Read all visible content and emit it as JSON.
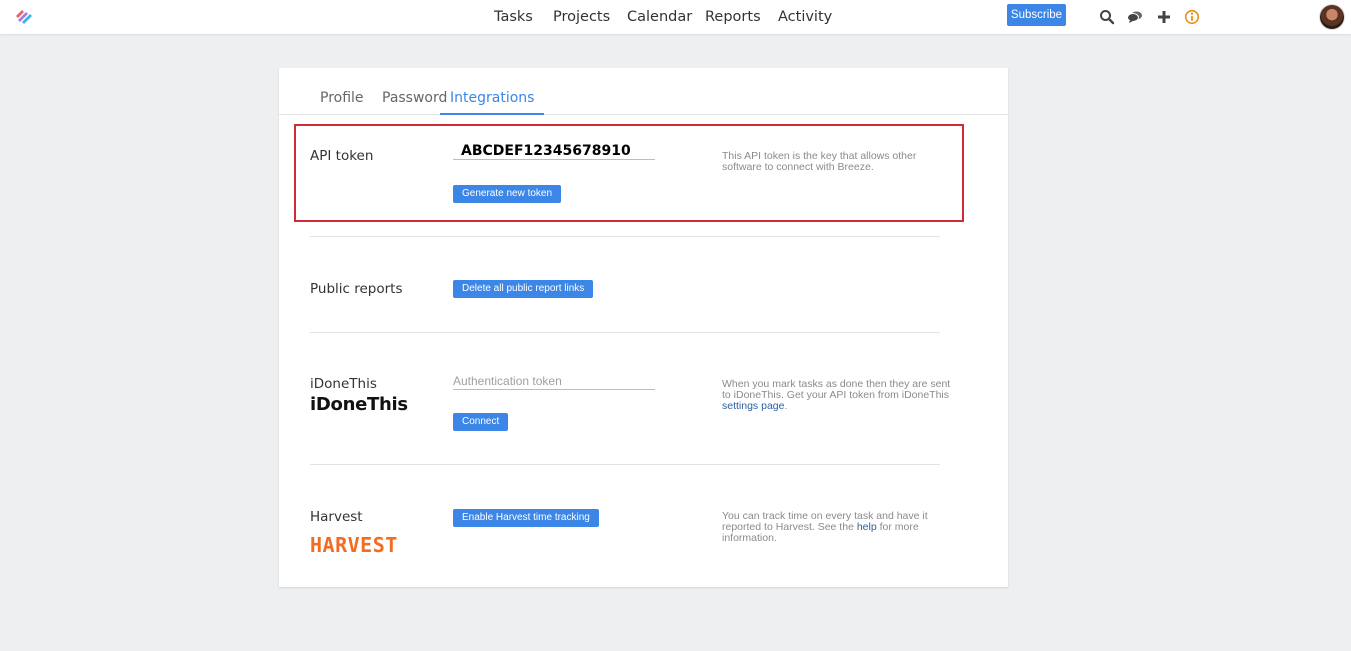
{
  "nav": {
    "items": [
      "Tasks",
      "Projects",
      "Calendar",
      "Reports",
      "Activity"
    ],
    "subscribe_label": "Subscribe",
    "icons": [
      "search-icon",
      "chat-icon",
      "plus-icon",
      "info-icon"
    ]
  },
  "tabs": [
    "Profile",
    "Password",
    "Integrations"
  ],
  "active_tab": "Integrations",
  "api": {
    "label": "API token",
    "token": "ABCDEF12345678910",
    "button": "Generate new token",
    "desc": "This API token is the key that allows other software to connect with Breeze."
  },
  "public_reports": {
    "label": "Public reports",
    "button": "Delete all public report links"
  },
  "idonethis": {
    "label": "iDoneThis",
    "brand": "iDoneThis",
    "placeholder": "Authentication token",
    "button": "Connect",
    "desc_before": "When you mark tasks as done then they are sent to iDoneThis. Get your API token from iDoneThis",
    "link": "settings page",
    "desc_after": "."
  },
  "harvest": {
    "label": "Harvest",
    "brand": "HARVEST",
    "button": "Enable Harvest time tracking",
    "desc_before": "You can track time on every task and have it reported to Harvest. See the",
    "link": "help",
    "desc_after": "for more information."
  },
  "colors": {
    "accent": "#3b86e6",
    "highlight_border": "#d02b36",
    "harvest_brand": "#f36c21",
    "info_icon": "#e8901a"
  }
}
